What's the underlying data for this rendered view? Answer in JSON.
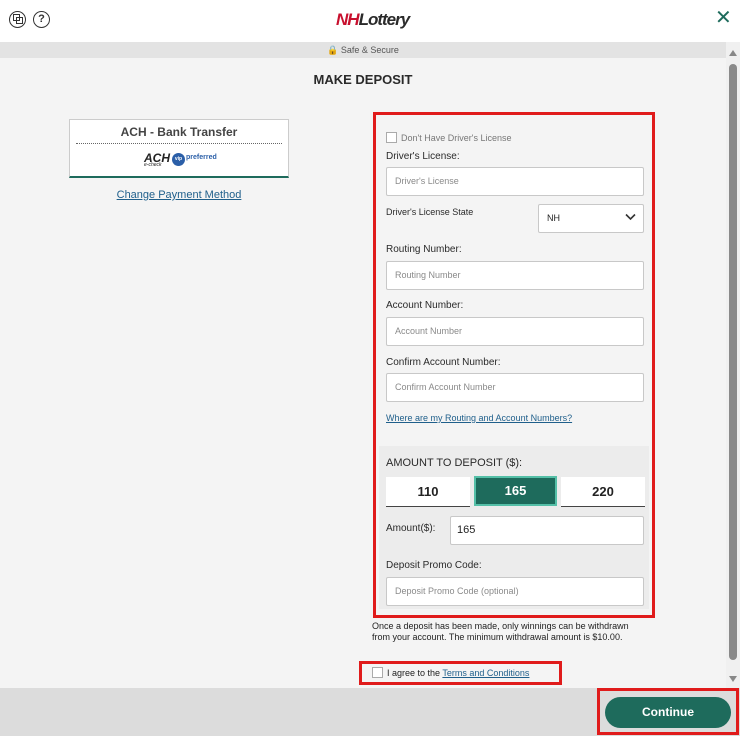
{
  "header": {
    "logo_nh": "NH",
    "logo_rest": "Lottery",
    "help_icon_glyph": "?",
    "close_glyph": "✕"
  },
  "secure_bar": {
    "text": "🔒 Safe & Secure"
  },
  "page": {
    "title": "MAKE DEPOSIT"
  },
  "payment": {
    "method_title": "ACH - Bank Transfer",
    "ach_logo": "ACH",
    "ach_sub": "e-check",
    "vip_badge": "vip",
    "vip_text": "preferred",
    "change_link": "Change Payment Method"
  },
  "form": {
    "no_license_label": "Don't Have Driver's License",
    "drivers_license": {
      "label": "Driver's License:",
      "placeholder": "Driver's License"
    },
    "license_state": {
      "label": "Driver's License State",
      "value": "NH"
    },
    "routing": {
      "label": "Routing Number:",
      "placeholder": "Routing Number"
    },
    "account": {
      "label": "Account Number:",
      "placeholder": "Account Number"
    },
    "confirm_account": {
      "label": "Confirm Account Number:",
      "placeholder": "Confirm Account Number"
    },
    "help_link": "Where are my Routing and Account Numbers?"
  },
  "deposit": {
    "title": "AMOUNT TO DEPOSIT ($):",
    "options": [
      "110",
      "165",
      "220"
    ],
    "selected": "165",
    "amount_label": "Amount($):",
    "amount_value": "165",
    "promo_label": "Deposit Promo Code:",
    "promo_placeholder": "Deposit Promo Code (optional)"
  },
  "disclaimer": "Once a deposit has been made, only winnings can be withdrawn from your account. The minimum withdrawal amount is $10.00.",
  "agree": {
    "prefix": "I agree to the ",
    "link": "Terms and Conditions"
  },
  "footer": {
    "continue_label": "Continue"
  },
  "colors": {
    "brand_green": "#1e6b5c",
    "highlight_red": "#e01b1b",
    "link_blue": "#1f5f8b",
    "logo_red": "#c8102e"
  }
}
